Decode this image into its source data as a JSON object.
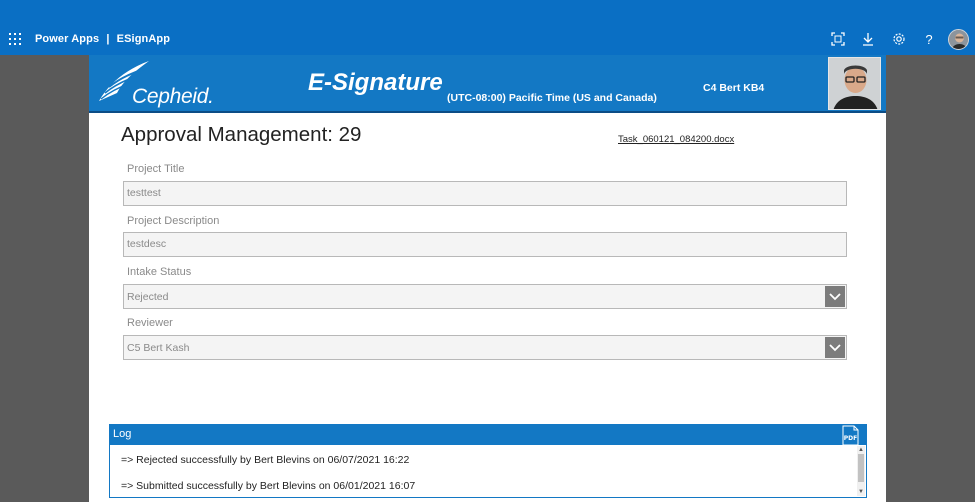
{
  "topbar": {
    "brand": "Power Apps",
    "separator": "|",
    "app_name": "ESignApp",
    "icons": [
      "waffle-icon",
      "fit-screen-icon",
      "download-icon",
      "settings-icon",
      "help-icon",
      "user-avatar"
    ]
  },
  "header": {
    "logo_text": "Cepheid.",
    "app_title": "E-Signature",
    "timezone": "(UTC-08:00) Pacific Time (US and Canada)",
    "user_name": "C4 Bert KB4"
  },
  "main": {
    "page_title": "Approval Management: 29",
    "document_link": "Task_060121_084200.docx",
    "fields": {
      "project_title_label": "Project Title",
      "project_title_value": "testtest",
      "project_description_label": "Project Description",
      "project_description_value": "testdesc",
      "intake_status_label": "Intake Status",
      "intake_status_value": "Rejected",
      "reviewer_label": "Reviewer",
      "reviewer_value": "C5 Bert Kash"
    }
  },
  "log": {
    "title": "Log",
    "entries": [
      "=> Rejected successfully by Bert Blevins on 06/07/2021 16:22",
      "=> Submitted successfully by Bert Blevins on 06/01/2021 16:07"
    ]
  },
  "colors": {
    "topbar": "#0a6fc4",
    "header": "#1378c4",
    "backdrop": "#5a5a5a"
  }
}
